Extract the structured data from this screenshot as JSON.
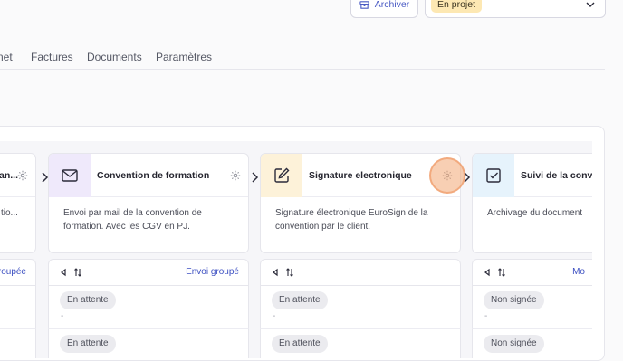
{
  "header": {
    "archive_label": "Archiver",
    "status_value": "En projet"
  },
  "tabs": [
    {
      "label": "net"
    },
    {
      "label": "Factures"
    },
    {
      "label": "Documents"
    },
    {
      "label": "Paramètres"
    }
  ],
  "columns": [
    {
      "title": "an...",
      "icon": "unknown-icon",
      "description": "tio...",
      "action_link": "roupée",
      "statuses": [
        "",
        ""
      ]
    },
    {
      "title": "Convention de formation",
      "icon": "mail-icon",
      "icon_bg": "#efe9fb",
      "description": "Envoi par mail de la convention de formation. Avec les CGV en PJ.",
      "action_link": "Envoi groupé",
      "statuses": [
        "En attente",
        "En attente"
      ],
      "dash": "-"
    },
    {
      "title": "Signature electronique",
      "icon": "edit-icon",
      "icon_bg": "#fdf2d9",
      "description": "Signature électronique EuroSign de la convention par le client.",
      "action_link": "",
      "statuses": [
        "En attente",
        "En attente"
      ],
      "dash": "-"
    },
    {
      "title": "Suivi de la conv",
      "icon": "checkbox-icon",
      "icon_bg": "#e6f3fc",
      "description": "Archivage du document",
      "action_link": "Mo",
      "statuses": [
        "Non signée",
        "Non signée"
      ],
      "dash": "-"
    }
  ],
  "colors": {
    "accent": "#3d50c2",
    "badge_bg": "#fde8b3",
    "highlight": "#f3a874"
  }
}
